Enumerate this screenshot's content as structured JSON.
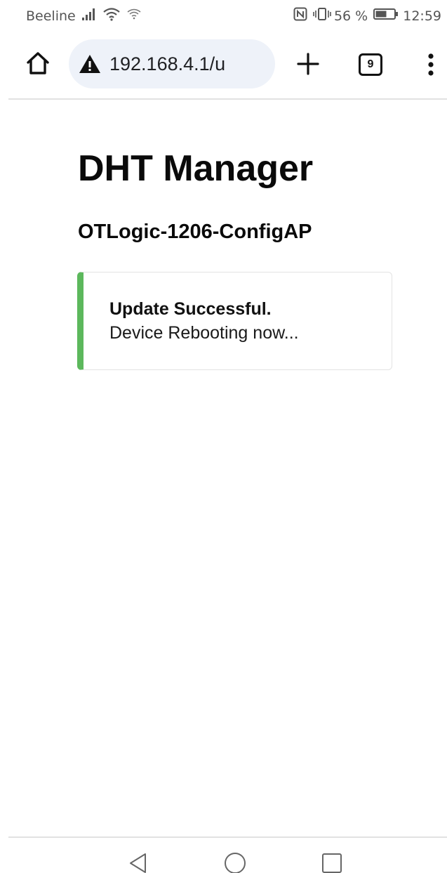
{
  "status_bar": {
    "carrier": "Beeline",
    "battery_percent": "56 %",
    "time": "12:59",
    "icons": [
      "signal-icon",
      "wifi-icon",
      "wifi-calling-icon",
      "nfc-icon",
      "vibrate-icon",
      "battery-icon"
    ]
  },
  "browser": {
    "url": "192.168.4.1/u",
    "tab_count": "9",
    "icons": [
      "home-icon",
      "warning-icon",
      "plus-icon",
      "tabs-icon",
      "more-vert-icon"
    ]
  },
  "page": {
    "title": "DHT Manager",
    "subtitle": "OTLogic-1206-ConfigAP",
    "alert": {
      "title": "Update Successful.",
      "body": "Device Rebooting now...",
      "accent_color": "#5cb85c"
    }
  },
  "nav_bar": {
    "icons": [
      "back-icon",
      "home-circle-icon",
      "recents-icon"
    ]
  }
}
